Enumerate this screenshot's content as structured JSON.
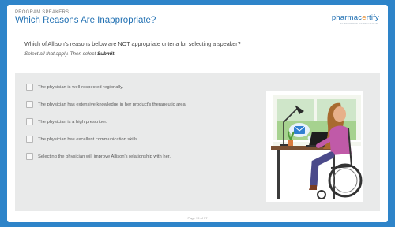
{
  "header": {
    "kicker": "PROGRAM SPEAKERS",
    "title": "Which Reasons Are Inappropriate?"
  },
  "logo": {
    "text_main": "pharmac",
    "text_accent": "e",
    "text_end": "rtify",
    "tagline": "BY NEWPORT NEWS GROUP"
  },
  "question": "Which of Allison's reasons below are NOT appropriate criteria for selecting a speaker?",
  "instruction": {
    "prefix": "Select all that apply. Then select ",
    "action": "Submit",
    "suffix": "."
  },
  "options": [
    {
      "label": "The physician is well-respected regionally.",
      "checked": false
    },
    {
      "label": "The physician has extensive knowledge in her product's therapeutic area.",
      "checked": false
    },
    {
      "label": "The physician is a high prescriber.",
      "checked": false
    },
    {
      "label": "The physician has excellent communication skills.",
      "checked": false
    },
    {
      "label": "Selecting the physician will improve Allison's relationship with her.",
      "checked": false
    }
  ],
  "footer": {
    "page": "Page 19 of 37"
  },
  "colors": {
    "background": "#2e84c9",
    "title": "#1f6fb2",
    "accent": "#e58a2b",
    "panel": "#e9eaea"
  }
}
